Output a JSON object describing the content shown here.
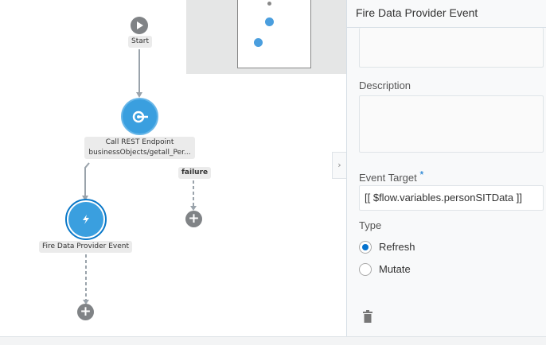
{
  "canvas": {
    "nodes": [
      {
        "label": "Start",
        "icon": "play-icon"
      },
      {
        "label_line1": "Call REST Endpoint",
        "label_line2": "businessObjects/getall_Per...",
        "icon": "rest-endpoint-icon"
      },
      {
        "label": "Fire Data Provider Event",
        "icon": "lightning-icon"
      }
    ],
    "failure_label": "failure"
  },
  "panel": {
    "title": "Fire Data Provider Event",
    "description_label": "Description",
    "event_target_label": "Event Target",
    "required_mark": "*",
    "event_target_value": "[[ $flow.variables.personSITData ]]",
    "type_label": "Type",
    "type_options": [
      {
        "label": "Refresh",
        "selected": true
      },
      {
        "label": "Mutate",
        "selected": false
      }
    ],
    "accent": "#0572ce"
  }
}
